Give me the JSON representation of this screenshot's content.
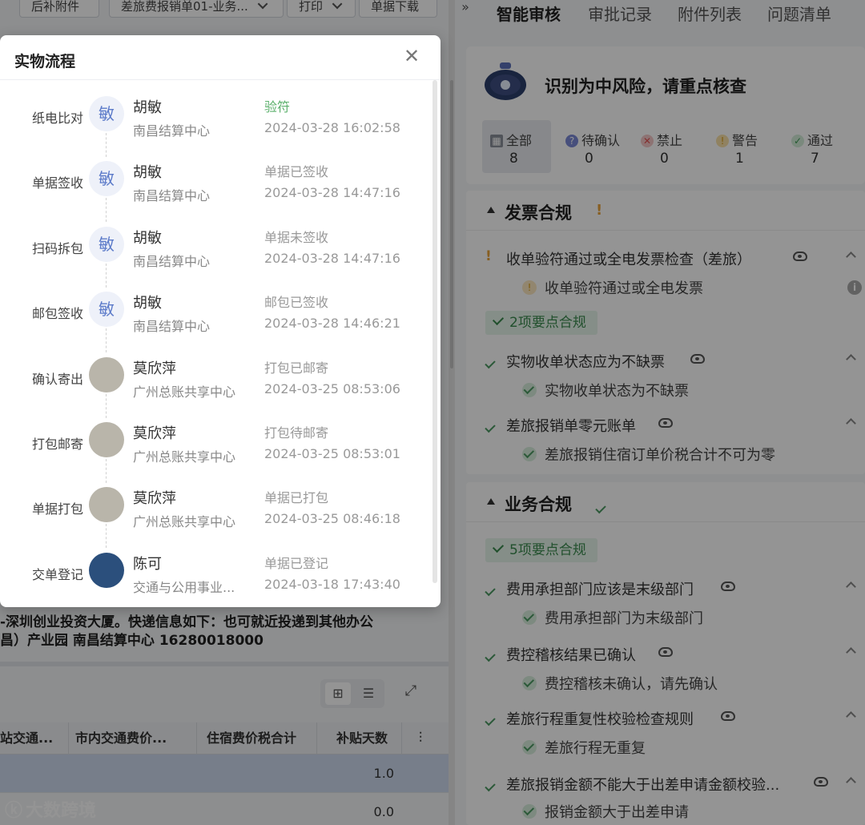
{
  "toolbar": {
    "btn_attach": "后补附件",
    "btn_template": "差旅费报销单01-业务...",
    "btn_print": "打印",
    "btn_download": "单据下载"
  },
  "background": {
    "address_line1": "-深圳创业投资大厦。快递信息如下：也可就近投递到其他办公",
    "address_line2": "昌）产业园 南昌结算中心 16280018000",
    "table": {
      "headers": [
        "站交通...",
        "市内交通费价...",
        "住宿费价税合计",
        "补贴天数"
      ],
      "rows": [
        {
          "subsidy_days": "1.0"
        },
        {
          "subsidy_days": "0.0"
        }
      ]
    },
    "watermark": "大数跨境"
  },
  "right_panel": {
    "tabs": [
      "智能审核",
      "审批记录",
      "附件列表",
      "问题清单"
    ],
    "risk_title": "识别为中风险，请重点核查",
    "stats": [
      {
        "label": "全部",
        "value": "8",
        "color": "#8a8f99"
      },
      {
        "label": "待确认",
        "value": "0",
        "color": "#7b88d6"
      },
      {
        "label": "禁止",
        "value": "0",
        "color": "#e57373"
      },
      {
        "label": "警告",
        "value": "1",
        "color": "#f2b23a"
      },
      {
        "label": "通过",
        "value": "7",
        "color": "#5cb06c"
      }
    ],
    "section_invoice": {
      "title": "发票合规",
      "rule1": "收单验符通过或全电发票检查（差旅）",
      "rule1_sub": "收单验符通过或全电发票",
      "pill": "2项要点合规",
      "rule2": "实物收单状态应为不缺票",
      "rule2_sub": "实物收单状态为不缺票",
      "rule3": "差旅报销单零元账单",
      "rule3_sub": "差旅报销住宿订单价税合计不可为零"
    },
    "section_business": {
      "title": "业务合规",
      "pill": "5项要点合规",
      "rule1": "费用承担部门应该是末级部门",
      "rule1_sub": "费用承担部门为末级部门",
      "rule2": "费控稽核结果已确认",
      "rule2_sub": "费控稽核未确认，请先确认",
      "rule3": "差旅行程重复性校验检查规则",
      "rule3_sub": "差旅行程无重复",
      "rule4": "差旅报销金额不能大于出差申请金额校验...",
      "rule4_sub": "报销金额大于出差申请"
    }
  },
  "dialog": {
    "title": "实物流程",
    "steps": [
      {
        "name": "纸电比对",
        "avatar": "敏",
        "person": "胡敏",
        "org": "南昌结算中心",
        "status": "验符",
        "time": "2024-03-28 16:02:58"
      },
      {
        "name": "单据签收",
        "avatar": "敏",
        "person": "胡敏",
        "org": "南昌结算中心",
        "status": "单据已签收",
        "time": "2024-03-28 14:47:16"
      },
      {
        "name": "扫码拆包",
        "avatar": "敏",
        "person": "胡敏",
        "org": "南昌结算中心",
        "status": "单据未签收",
        "time": "2024-03-28 14:47:16"
      },
      {
        "name": "邮包签收",
        "avatar": "敏",
        "person": "胡敏",
        "org": "南昌结算中心",
        "status": "邮包已签收",
        "time": "2024-03-28 14:46:21"
      },
      {
        "name": "确认寄出",
        "avatar": "",
        "person": "莫欣萍",
        "org": "广州总账共享中心",
        "status": "打包已邮寄",
        "time": "2024-03-25 08:53:06"
      },
      {
        "name": "打包邮寄",
        "avatar": "",
        "person": "莫欣萍",
        "org": "广州总账共享中心",
        "status": "打包待邮寄",
        "time": "2024-03-25 08:53:01"
      },
      {
        "name": "单据打包",
        "avatar": "",
        "person": "莫欣萍",
        "org": "广州总账共享中心",
        "status": "单据已打包",
        "time": "2024-03-25 08:46:18"
      },
      {
        "name": "交单登记",
        "avatar": "",
        "person": "陈可",
        "org": "交通与公用事业...",
        "status": "单据已登记",
        "time": "2024-03-18 17:43:40"
      }
    ]
  }
}
